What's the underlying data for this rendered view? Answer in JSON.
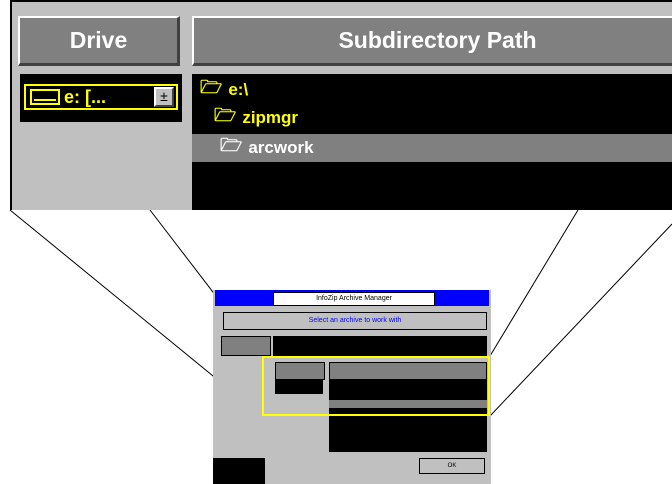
{
  "zoomed": {
    "headers": {
      "drive": "Drive",
      "path": "Subdirectory Path"
    },
    "drive_select": {
      "value": "e: [...",
      "button_glyph": "±"
    },
    "path_items": [
      {
        "label": "e:\\",
        "icon": "open-folder-icon",
        "selected": false
      },
      {
        "label": "zipmgr",
        "icon": "open-folder-icon",
        "selected": false
      },
      {
        "label": "arcwork",
        "icon": "open-folder-icon",
        "selected": true
      }
    ]
  },
  "thumbnail": {
    "title": "InfoZip Archive Manager",
    "bar_text": "Select an archive to work with",
    "button": "OK"
  },
  "colors": {
    "highlight": "#ffff00",
    "panel": "#c0c0c0",
    "header": "#808080",
    "title_bar": "#0000ff"
  }
}
